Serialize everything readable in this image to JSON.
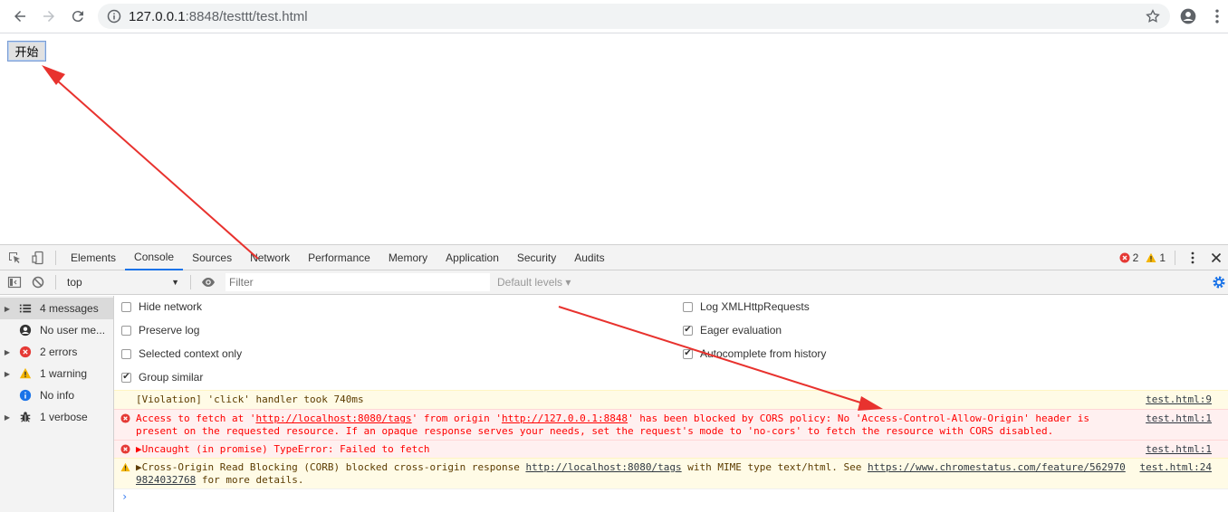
{
  "browser": {
    "url_host": "127.0.0.1",
    "url_rest": ":8848/testtt/test.html"
  },
  "page": {
    "start_button": "开始"
  },
  "devtools": {
    "tabs": [
      "Elements",
      "Console",
      "Sources",
      "Network",
      "Performance",
      "Memory",
      "Application",
      "Security",
      "Audits"
    ],
    "error_count": "2",
    "warning_count": "1",
    "context": "top",
    "filter_placeholder": "Filter",
    "levels": "Default levels ▾",
    "sidebar": [
      {
        "label": "4 messages",
        "icon": "list-icon"
      },
      {
        "label": "No user me...",
        "icon": "user-icon"
      },
      {
        "label": "2 errors",
        "icon": "error-icon"
      },
      {
        "label": "1 warning",
        "icon": "warning-icon"
      },
      {
        "label": "No info",
        "icon": "info-icon"
      },
      {
        "label": "1 verbose",
        "icon": "bug-icon"
      }
    ],
    "settings": {
      "hide_network": "Hide network",
      "preserve_log": "Preserve log",
      "selected_context": "Selected context only",
      "group_similar": "Group similar",
      "log_xhr": "Log XMLHttpRequests",
      "eager_eval": "Eager evaluation",
      "autocomplete": "Autocomplete from history"
    },
    "messages": {
      "m1_text": "[Violation] 'click' handler took 740ms",
      "m1_src": "test.html:9",
      "m2_a": "Access to fetch at '",
      "m2_link1": "http://localhost:8080/tags",
      "m2_b": "' from origin '",
      "m2_link2": "http://127.0.0.1:8848",
      "m2_c": "' has been blocked by CORS policy: No 'Access-Control-Allow-Origin' header is present on the requested resource. If an opaque response serves your needs, set the request's mode to 'no-cors' to fetch the resource with CORS disabled.",
      "m2_src": "test.html:1",
      "m3_text": "▶Uncaught (in promise) TypeError: Failed to fetch",
      "m3_src": "test.html:1",
      "m4_a": "▶Cross-Origin Read Blocking (CORB) blocked cross-origin response ",
      "m4_link1": "http://localhost:8080/tags",
      "m4_b": " with MIME type text/html. See ",
      "m4_link2": "https://www.chromestatus.com/feature/5629709824032768",
      "m4_c": " for more details.",
      "m4_src": "test.html:24"
    },
    "prompt": "›"
  },
  "colors": {
    "accent": "#1a73e8",
    "error": "#ff0000",
    "warning_bg": "#fffbe6",
    "error_bg": "#fff0f0",
    "annotation_arrow": "#e8322e"
  }
}
